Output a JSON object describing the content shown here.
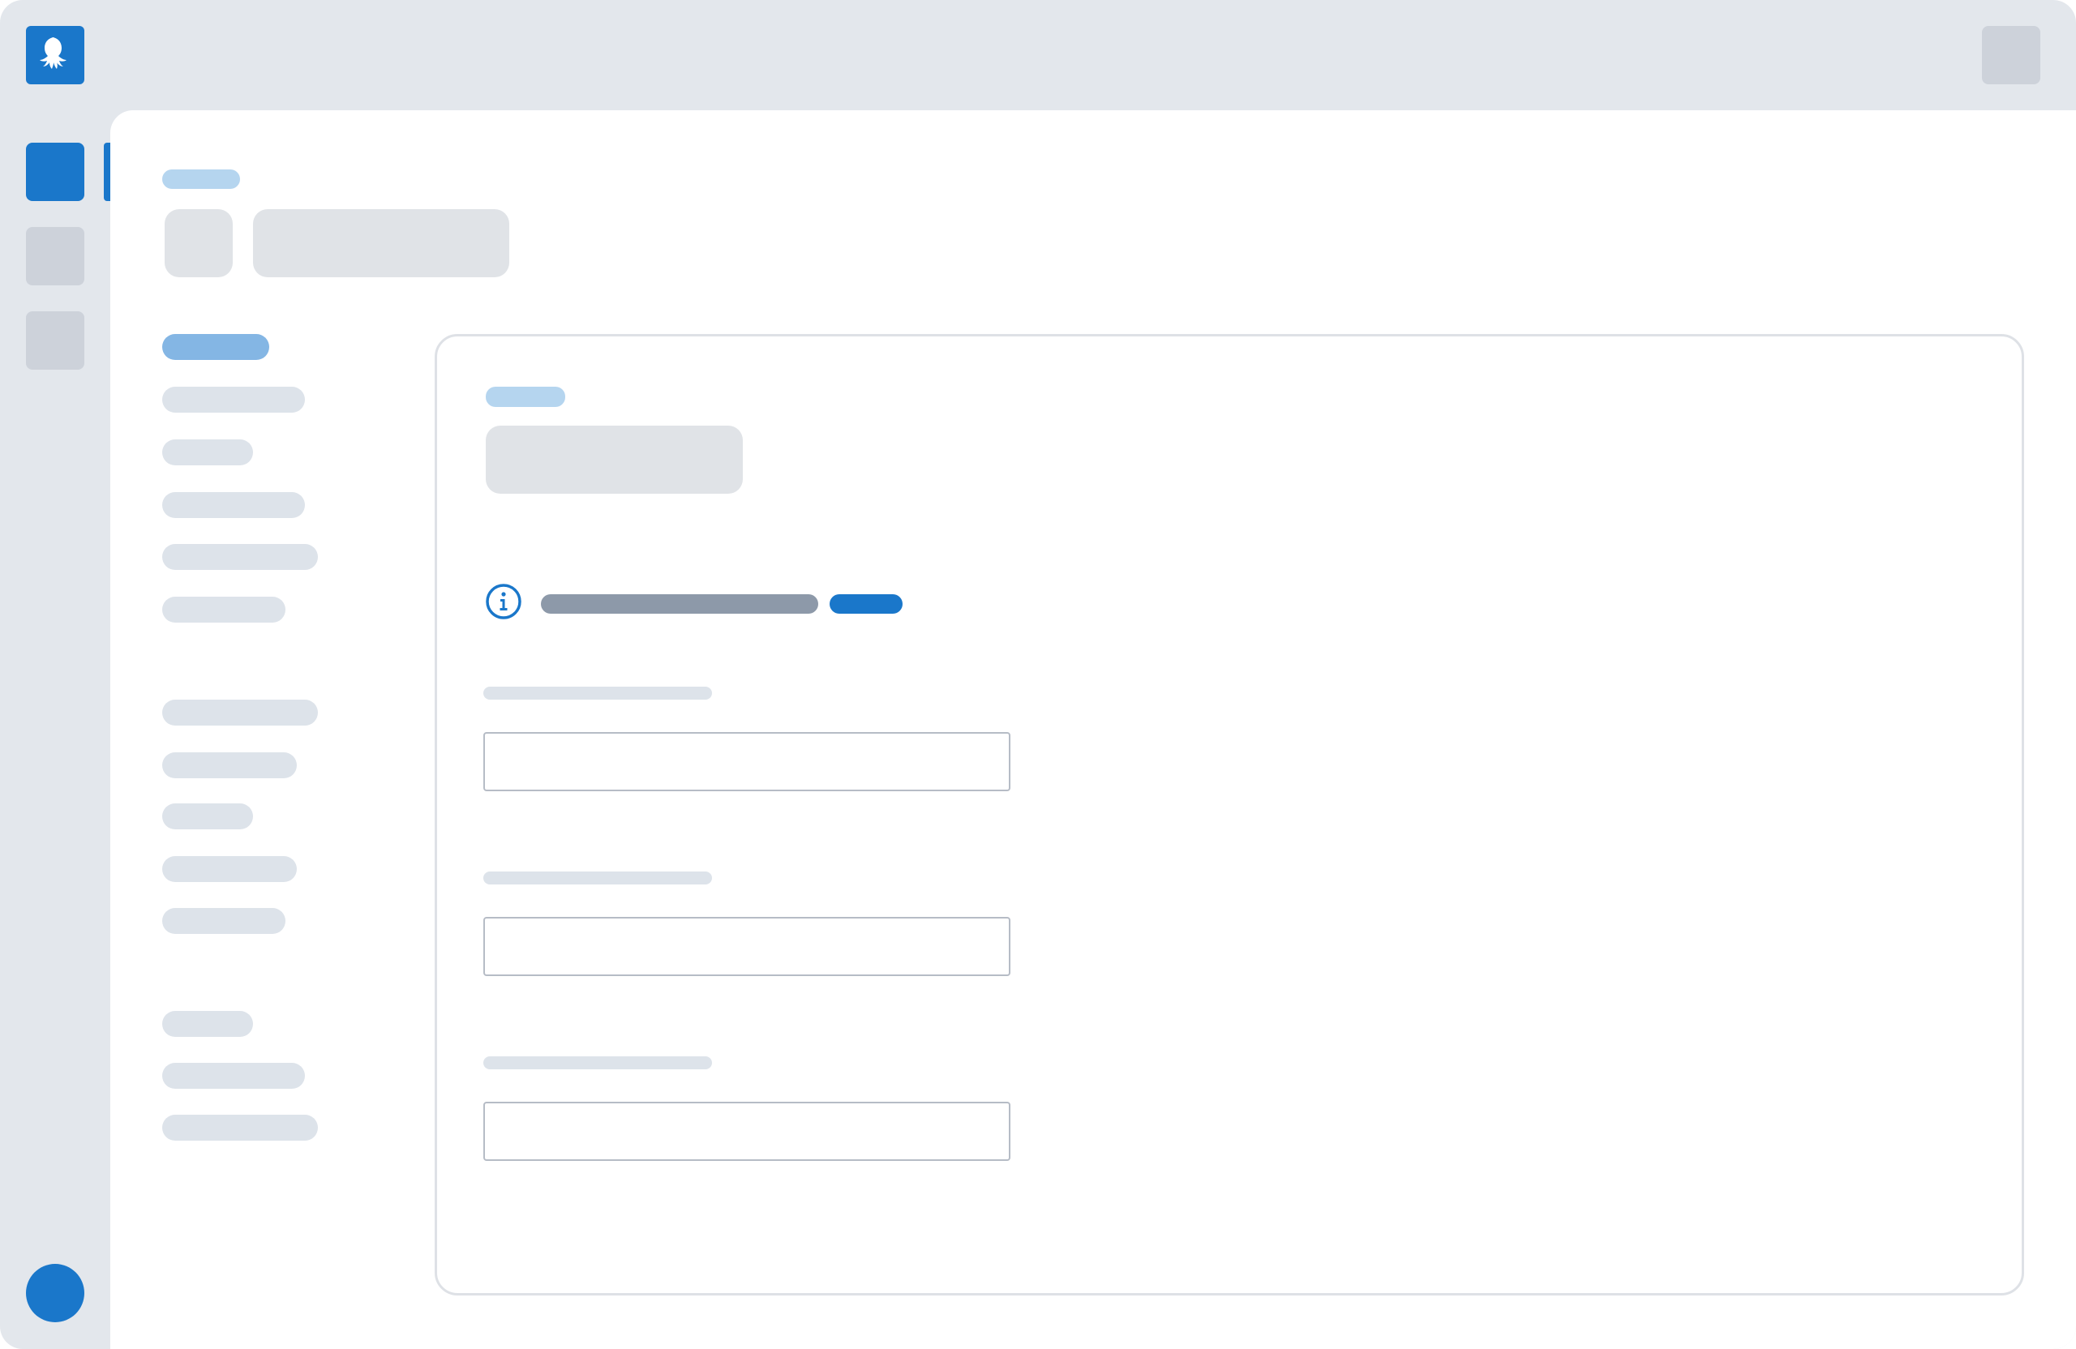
{
  "app": {
    "logo_icon": "octopus-logo-icon",
    "brand_color": "#1a77ca"
  },
  "rail": {
    "items": [
      {
        "icon": "nav-item-active",
        "active": true
      },
      {
        "icon": "nav-item",
        "active": false
      },
      {
        "icon": "nav-item",
        "active": false
      }
    ],
    "avatar_icon": "user-avatar"
  },
  "header": {
    "breadcrumb": "",
    "title": ""
  },
  "subnav": {
    "groups": [
      {
        "items": [
          {
            "label": "",
            "active": true
          },
          {
            "label": ""
          },
          {
            "label": ""
          },
          {
            "label": ""
          },
          {
            "label": ""
          },
          {
            "label": ""
          }
        ]
      },
      {
        "items": [
          {
            "label": ""
          },
          {
            "label": ""
          },
          {
            "label": ""
          },
          {
            "label": ""
          },
          {
            "label": ""
          }
        ]
      },
      {
        "items": [
          {
            "label": ""
          },
          {
            "label": ""
          },
          {
            "label": ""
          }
        ]
      }
    ]
  },
  "card": {
    "eyebrow": "",
    "title": "",
    "info": {
      "icon": "info-icon",
      "text": "",
      "link": ""
    },
    "fields": [
      {
        "label": "",
        "value": "",
        "placeholder": ""
      },
      {
        "label": "",
        "value": "",
        "placeholder": ""
      },
      {
        "label": "",
        "value": "",
        "placeholder": ""
      }
    ]
  }
}
